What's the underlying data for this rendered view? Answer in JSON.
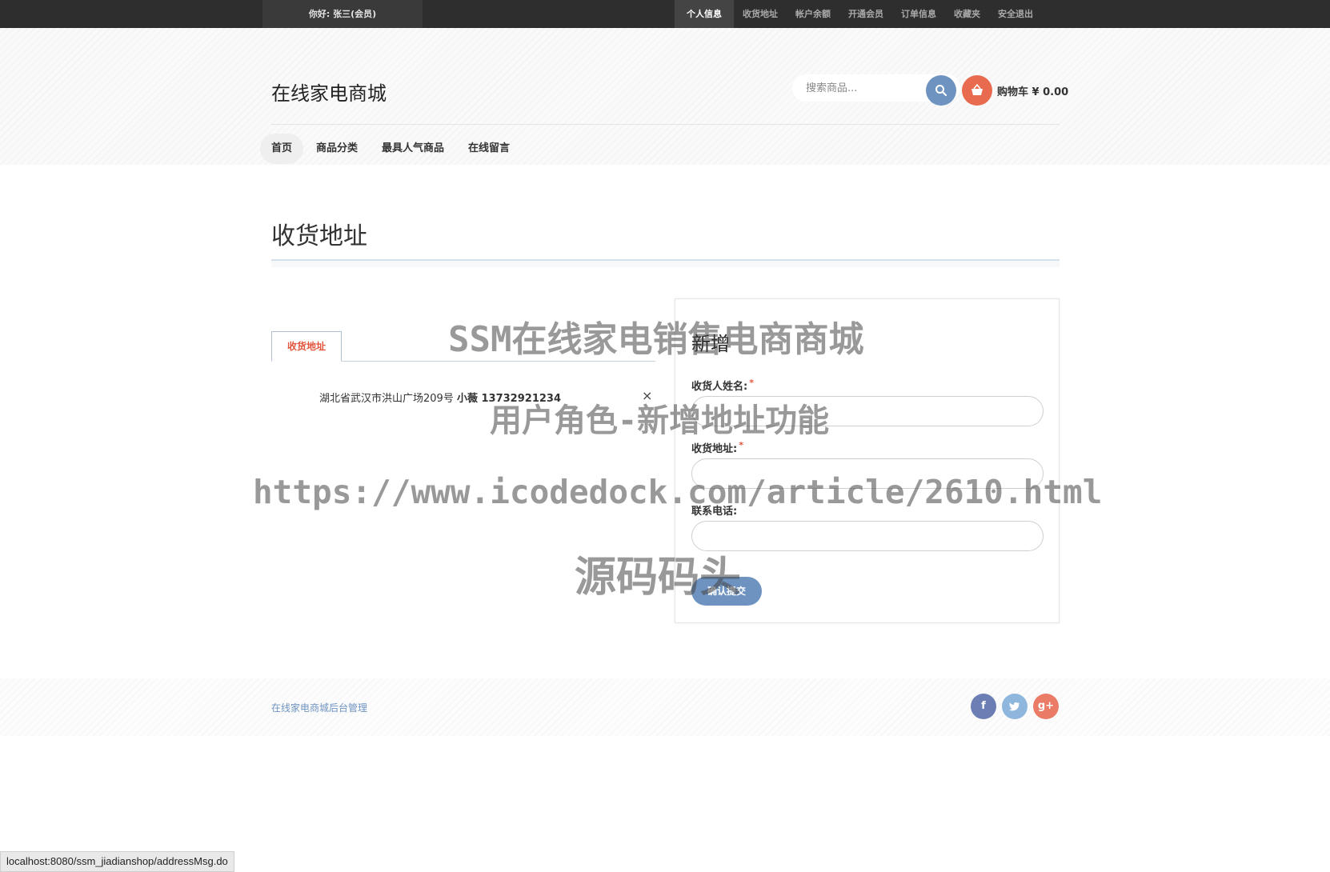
{
  "topbar": {
    "greeting": "你好: 张三(会员)",
    "links": [
      "个人信息",
      "收货地址",
      "帐户余额",
      "开通会员",
      "订单信息",
      "收藏夹",
      "安全退出"
    ]
  },
  "header": {
    "logo": "在线家电商城",
    "search_placeholder": "搜索商品...",
    "search_icon": "search-icon",
    "cart_icon": "basket-icon",
    "cart_label": "购物车 ¥ 0.00"
  },
  "nav": {
    "items": [
      "首页",
      "商品分类",
      "最具人气商品",
      "在线留言"
    ]
  },
  "page": {
    "title": "收货地址",
    "tab_label": "收货地址",
    "address": {
      "text": "湖北省武汉市洪山广场209号",
      "name_phone": "小薇 13732921234",
      "delete_glyph": "×"
    }
  },
  "form": {
    "title": "新增",
    "name_label": "收货人姓名:",
    "address_label": "收货地址:",
    "phone_label": "联系电话:",
    "required_mark": "*",
    "submit_label": "确认提交"
  },
  "watermark": {
    "line1": "SSM在线家电销售电商商城",
    "line2": "用户角色-新增地址功能",
    "line3": "https://www.icodedock.com/article/2610.html",
    "line4": "源码码头"
  },
  "footer": {
    "admin_link": "在线家电商城后台管理",
    "social": [
      "f",
      "t",
      "g+"
    ]
  },
  "statusbar": {
    "url": "localhost:8080/ssm_jiadianshop/addressMsg.do"
  },
  "colors": {
    "accent_blue": "#6e93c1",
    "accent_red": "#e96b4f",
    "topbar_bg": "#2e2e2e"
  }
}
